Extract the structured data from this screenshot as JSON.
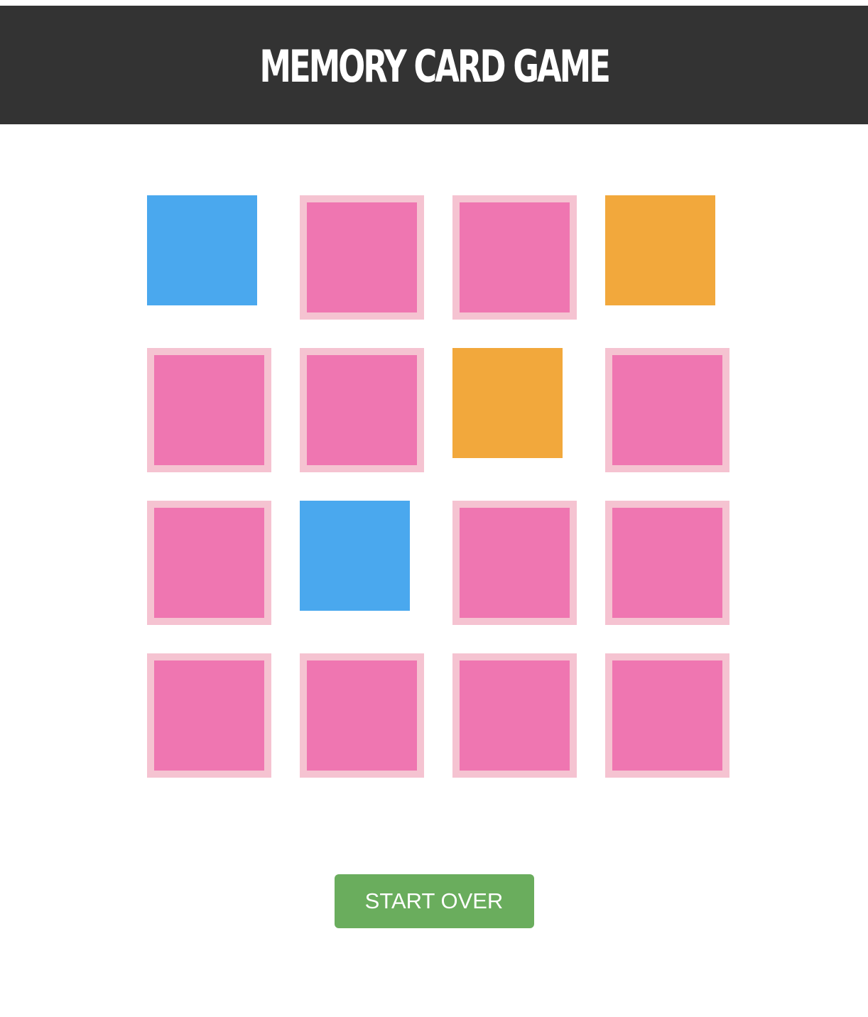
{
  "header": {
    "title": "MEMORY CARD GAME"
  },
  "colors": {
    "header_bg": "#333333",
    "card_back_fill": "#ef76b1",
    "card_back_border": "#f5c3d1",
    "button_bg": "#6aad5d",
    "button_text": "#ffffff"
  },
  "board": {
    "columns": 4,
    "rows": 4,
    "cards": [
      {
        "state": "face-up",
        "color": "#4aa8ee"
      },
      {
        "state": "face-down"
      },
      {
        "state": "face-down"
      },
      {
        "state": "face-up",
        "color": "#f2a83c"
      },
      {
        "state": "face-down"
      },
      {
        "state": "face-down"
      },
      {
        "state": "face-up",
        "color": "#f2a83c"
      },
      {
        "state": "face-down"
      },
      {
        "state": "face-down"
      },
      {
        "state": "face-up",
        "color": "#4aa8ee"
      },
      {
        "state": "face-down"
      },
      {
        "state": "face-down"
      },
      {
        "state": "face-down"
      },
      {
        "state": "face-down"
      },
      {
        "state": "face-down"
      },
      {
        "state": "face-down"
      }
    ]
  },
  "controls": {
    "restart_label": "START OVER"
  }
}
